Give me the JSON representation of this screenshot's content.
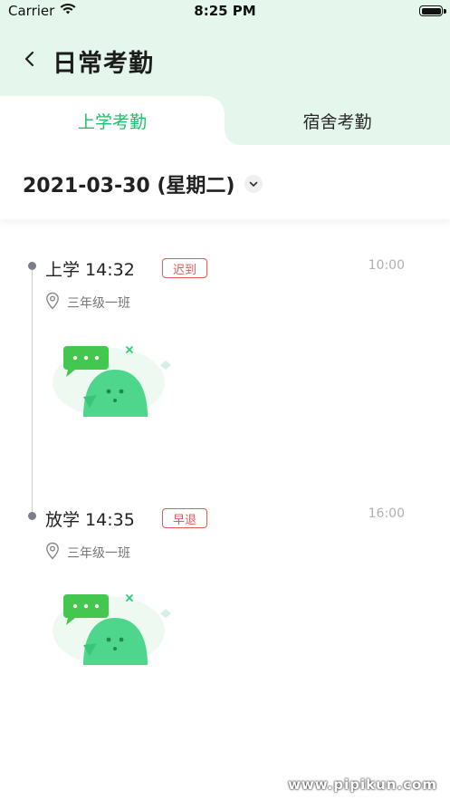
{
  "status_bar": {
    "carrier": "Carrier",
    "time": "8:25 PM"
  },
  "header": {
    "title": "日常考勤"
  },
  "tabs": [
    {
      "label": "上学考勤",
      "active": true
    },
    {
      "label": "宿舍考勤",
      "active": false
    }
  ],
  "date": {
    "value": "2021-03-30 (星期二)"
  },
  "records": [
    {
      "type_time": "上学 14:32",
      "tag": "迟到",
      "expected_time": "10:00",
      "location": "三年级一班"
    },
    {
      "type_time": "放学 14:35",
      "tag": "早退",
      "expected_time": "16:00",
      "location": "三年级一班"
    }
  ],
  "watermark": "www.pipikun.com",
  "colors": {
    "accent": "#1fc06b",
    "header_bg": "#e5f7ec",
    "tag_red": "#e35b5b",
    "muted": "#b0b0b0"
  }
}
